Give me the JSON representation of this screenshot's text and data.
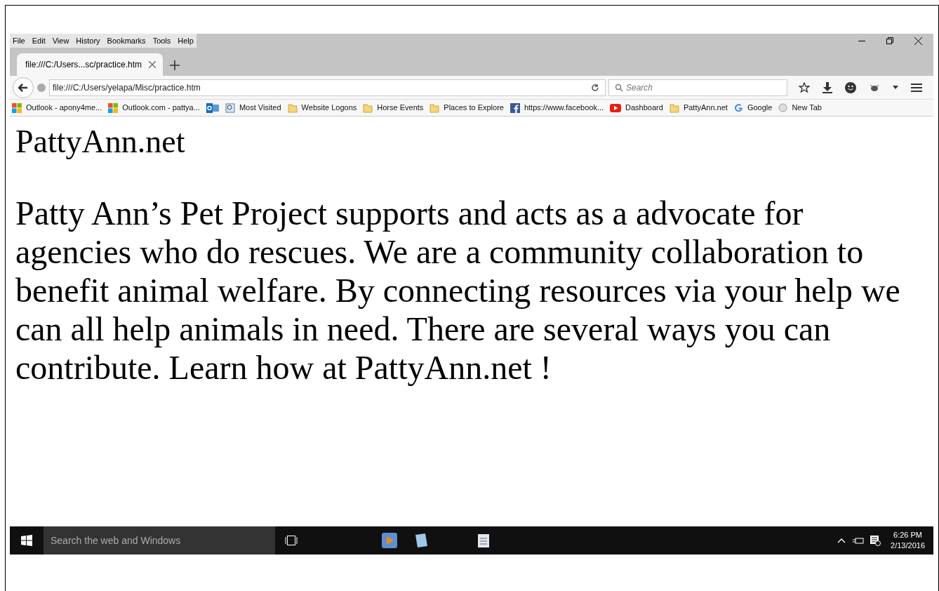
{
  "menu": [
    "File",
    "Edit",
    "View",
    "History",
    "Bookmarks",
    "Tools",
    "Help"
  ],
  "tabs": [
    {
      "label": "file:///C:/Users...sc/practice.htm",
      "selected": true
    }
  ],
  "address": {
    "value": "file:///C:/Users/yelapa/Misc/practice.htm"
  },
  "search": {
    "placeholder": "Search"
  },
  "bookmarks": [
    {
      "kind": "ms",
      "label": "Outlook - apony4me..."
    },
    {
      "kind": "ms",
      "label": "Outlook.com - pattya..."
    },
    {
      "kind": "outlook"
    },
    {
      "kind": "visited",
      "label": "Most Visited"
    },
    {
      "kind": "folder",
      "label": "Website Logons"
    },
    {
      "kind": "folder",
      "label": "Horse Events"
    },
    {
      "kind": "folder",
      "label": "Places to Explore"
    },
    {
      "kind": "facebook",
      "label": "https://www.facebook..."
    },
    {
      "kind": "youtube",
      "label": "Dashboard"
    },
    {
      "kind": "folder",
      "label": "PattyAnn.net"
    },
    {
      "kind": "google",
      "label": "Google"
    },
    {
      "kind": "globe",
      "label": "New Tab"
    }
  ],
  "page": {
    "heading": "PattyAnn.net",
    "paragraph": "Patty Ann’s Pet Project supports and acts as a advocate for agencies who do rescues. We are a community collaboration to benefit animal welfare. By connecting resources via your help we can all help animals in need. There are several ways you can contribute. Learn how at PattyAnn.net !"
  },
  "taskbar": {
    "search_placeholder": "Search the web and Windows",
    "time": "6:26 PM",
    "date": "2/13/2016"
  }
}
